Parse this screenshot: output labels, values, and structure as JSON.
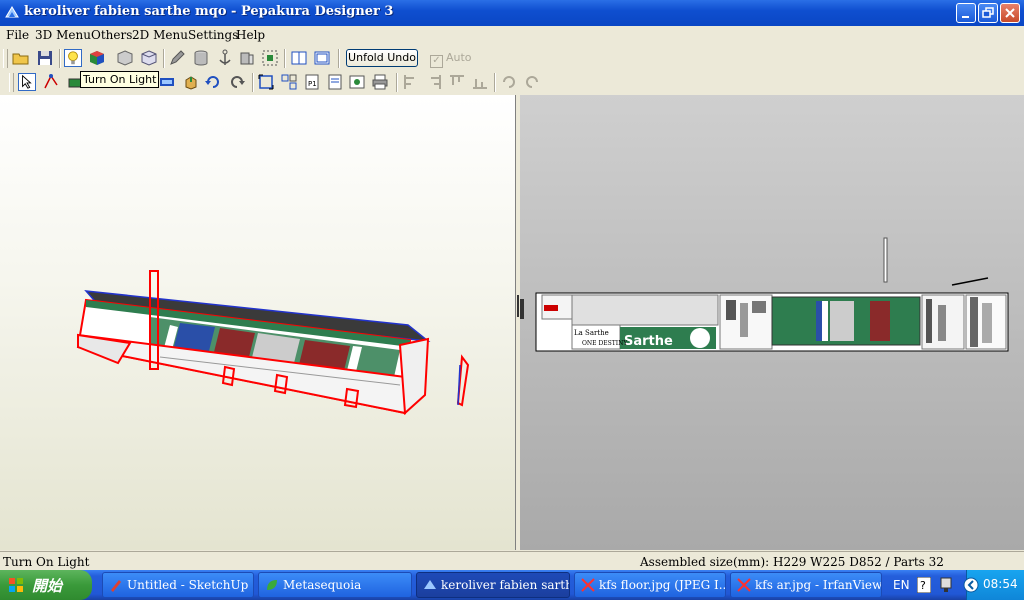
{
  "window": {
    "title": "keroliver fabien sarthe mqo - Pepakura Designer 3"
  },
  "menu": [
    "File",
    "3D Menu",
    "Others",
    "2D Menu",
    "Settings",
    "Help"
  ],
  "toolbar": {
    "unfold_undo": "Unfold Undo",
    "auto_label": "Auto",
    "auto_checked": true,
    "tooltip": "Turn On Light"
  },
  "model": {
    "logo_text": "Sarthe",
    "small_text_1": "La Sarthe",
    "small_text_2": "ONE DESTINY"
  },
  "status": {
    "left": "Turn On Light",
    "right": "Assembled size(mm): H229 W225 D852 / Parts 32"
  },
  "taskbar": {
    "start": "開始",
    "tasks": [
      {
        "label": "Untitled - SketchUp"
      },
      {
        "label": "Metasequoia"
      },
      {
        "label": "keroliver fabien sarthe..."
      },
      {
        "label": "kfs floor.jpg (JPEG I..."
      },
      {
        "label": "kfs ar.jpg - IrfanView ..."
      }
    ],
    "lang": "EN",
    "clock": "08:54"
  },
  "colors": {
    "title_blue": "#0a46c4",
    "model_red": "#ff0000",
    "model_green": "#2e7d4f",
    "pane_gray": "#b5b5b5"
  }
}
